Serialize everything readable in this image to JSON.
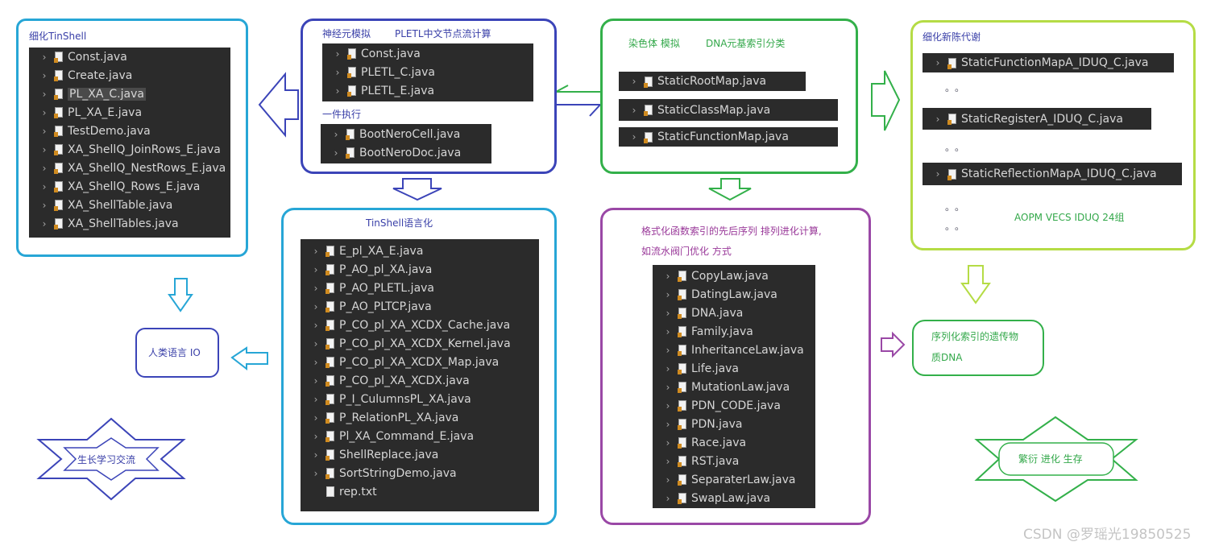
{
  "colors": {
    "blue_dark": "#3b44b8",
    "cyan": "#27a6d6",
    "green": "#33b04a",
    "lime": "#b5dc45",
    "purple": "#9a48a6",
    "text_blue": "#3a40a8",
    "text_green": "#33a84a",
    "text_purple": "#9a3a9a"
  },
  "box_tinshell": {
    "title": "细化TinShell",
    "files": [
      {
        "name": "Const.java",
        "selected": false
      },
      {
        "name": "Create.java",
        "selected": false
      },
      {
        "name": "PL_XA_C.java",
        "selected": true
      },
      {
        "name": "PL_XA_E.java",
        "selected": false
      },
      {
        "name": "TestDemo.java",
        "selected": false
      },
      {
        "name": "XA_ShellQ_JoinRows_E.java",
        "selected": false
      },
      {
        "name": "XA_ShellQ_NestRows_E.java",
        "selected": false
      },
      {
        "name": "XA_ShellQ_Rows_E.java",
        "selected": false
      },
      {
        "name": "XA_ShellTable.java",
        "selected": false
      },
      {
        "name": "XA_ShellTables.java",
        "selected": false
      }
    ]
  },
  "box_neuron": {
    "title1": "神经元模拟",
    "title2": "PLETL中文节点流计算",
    "files1": [
      "Const.java",
      "PLETL_C.java",
      "PLETL_E.java"
    ],
    "title3": "一件执行",
    "files2": [
      "BootNeroCell.java",
      "BootNeroDoc.java"
    ]
  },
  "box_chromosome": {
    "title1": "染色体  模拟",
    "title2": "DNA元基索引分类",
    "files": [
      "StaticRootMap.java",
      "StaticClassMap.java",
      "StaticFunctionMap.java"
    ]
  },
  "box_metabolism": {
    "title": "细化新陈代谢",
    "files": [
      "StaticFunctionMapA_IDUQ_C.java",
      "StaticRegisterA_IDUQ_C.java",
      "StaticReflectionMapA_IDUQ_C.java"
    ],
    "dots": "。。",
    "note": "AOPM VECS IDUQ 24组"
  },
  "box_language": {
    "title": "TinShell语言化",
    "files": [
      "E_pl_XA_E.java",
      "P_AO_pl_XA.java",
      "P_AO_PLETL.java",
      "P_AO_PLTCP.java",
      "P_CO_pl_XA_XCDX_Cache.java",
      "P_CO_pl_XA_XCDX_Kernel.java",
      "P_CO_pl_XA_XCDX_Map.java",
      "P_CO_pl_XA_XCDX.java",
      "P_I_CulumnsPL_XA.java",
      "P_RelationPL_XA.java",
      "Pl_XA_Command_E.java",
      "ShellReplace.java",
      "SortStringDemo.java",
      "rep.txt"
    ]
  },
  "box_format": {
    "title1": "格式化函数索引的先后序列 排列进化计算,",
    "title2": "如流水阀门优化 方式",
    "files": [
      "CopyLaw.java",
      "DatingLaw.java",
      "DNA.java",
      "Family.java",
      "InheritanceLaw.java",
      "Life.java",
      "MutationLaw.java",
      "PDN_CODE.java",
      "PDN.java",
      "Race.java",
      "RST.java",
      "SeparaterLaw.java",
      "SwapLaw.java"
    ]
  },
  "box_io": {
    "label": "人类语言 IO"
  },
  "box_dna": {
    "line1": "序列化索引的遗传物",
    "line2": "质DNA"
  },
  "star_left": {
    "label": "生长学习交流"
  },
  "star_right": {
    "label": "繁衍 进化 生存"
  },
  "watermark": "CSDN @罗瑶光19850525",
  "icons": {
    "expand": "chevron-right-icon",
    "java_file": "java-file-icon",
    "text_file": "text-file-icon"
  }
}
